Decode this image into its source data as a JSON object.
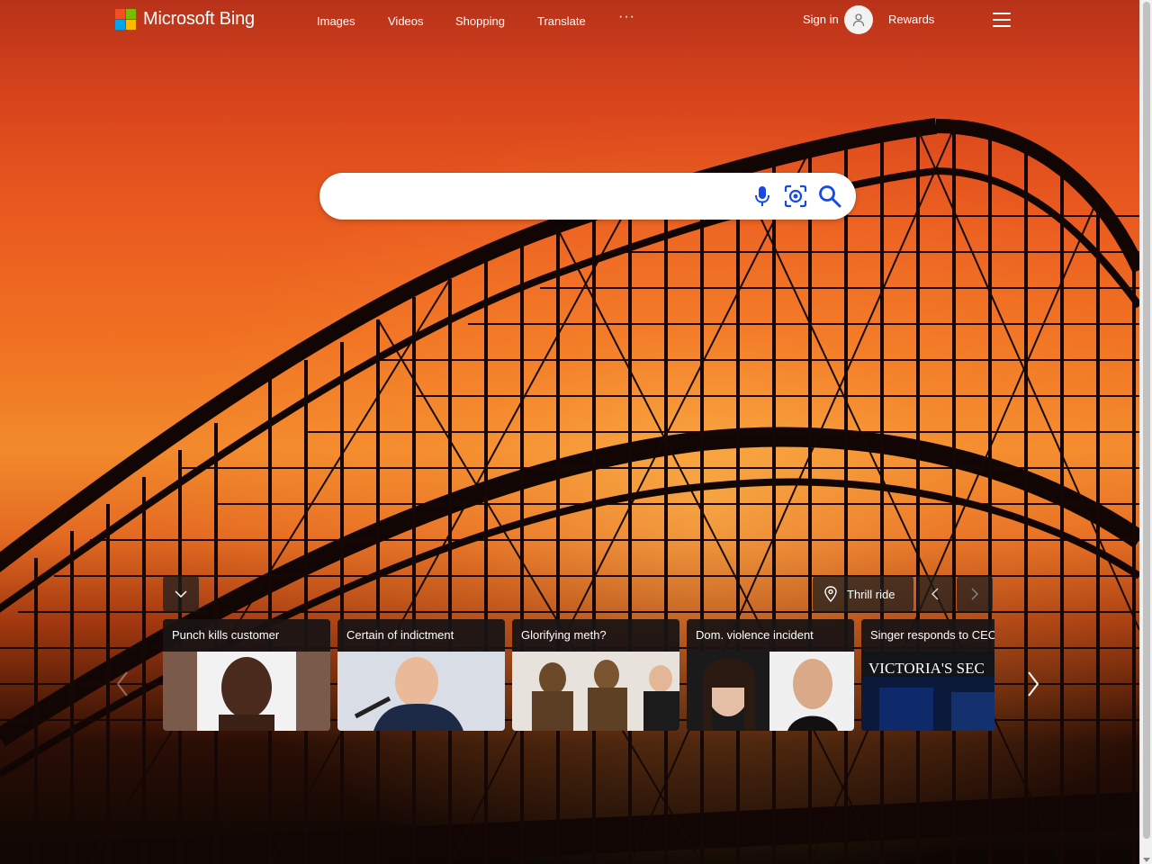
{
  "header": {
    "logo_text": "Microsoft Bing",
    "nav": [
      "Images",
      "Videos",
      "Shopping",
      "Translate"
    ],
    "more_label": "···",
    "signin_label": "Sign in",
    "rewards_label": "Rewards"
  },
  "search": {
    "value": "",
    "placeholder": ""
  },
  "image_info": {
    "label": "Thrill ride"
  },
  "news": [
    {
      "title": "Punch kills customer"
    },
    {
      "title": "Certain of indictment"
    },
    {
      "title": "Glorifying meth?"
    },
    {
      "title": "Dom. violence incident"
    },
    {
      "title": "Singer responds to CEO"
    }
  ],
  "news_overlay_text": {
    "card5_sign": "VICTORIA'S SEC"
  },
  "colors": {
    "ms_red": "#f25022",
    "ms_green": "#7fba00",
    "ms_blue": "#00a4ef",
    "ms_yellow": "#ffb900",
    "search_icon": "#174ae4"
  },
  "icons": [
    "microphone-icon",
    "visual-search-icon",
    "search-icon",
    "user-icon",
    "hamburger-menu-icon",
    "chevron-down-icon",
    "location-pin-icon",
    "chevron-left-icon",
    "chevron-right-icon"
  ]
}
